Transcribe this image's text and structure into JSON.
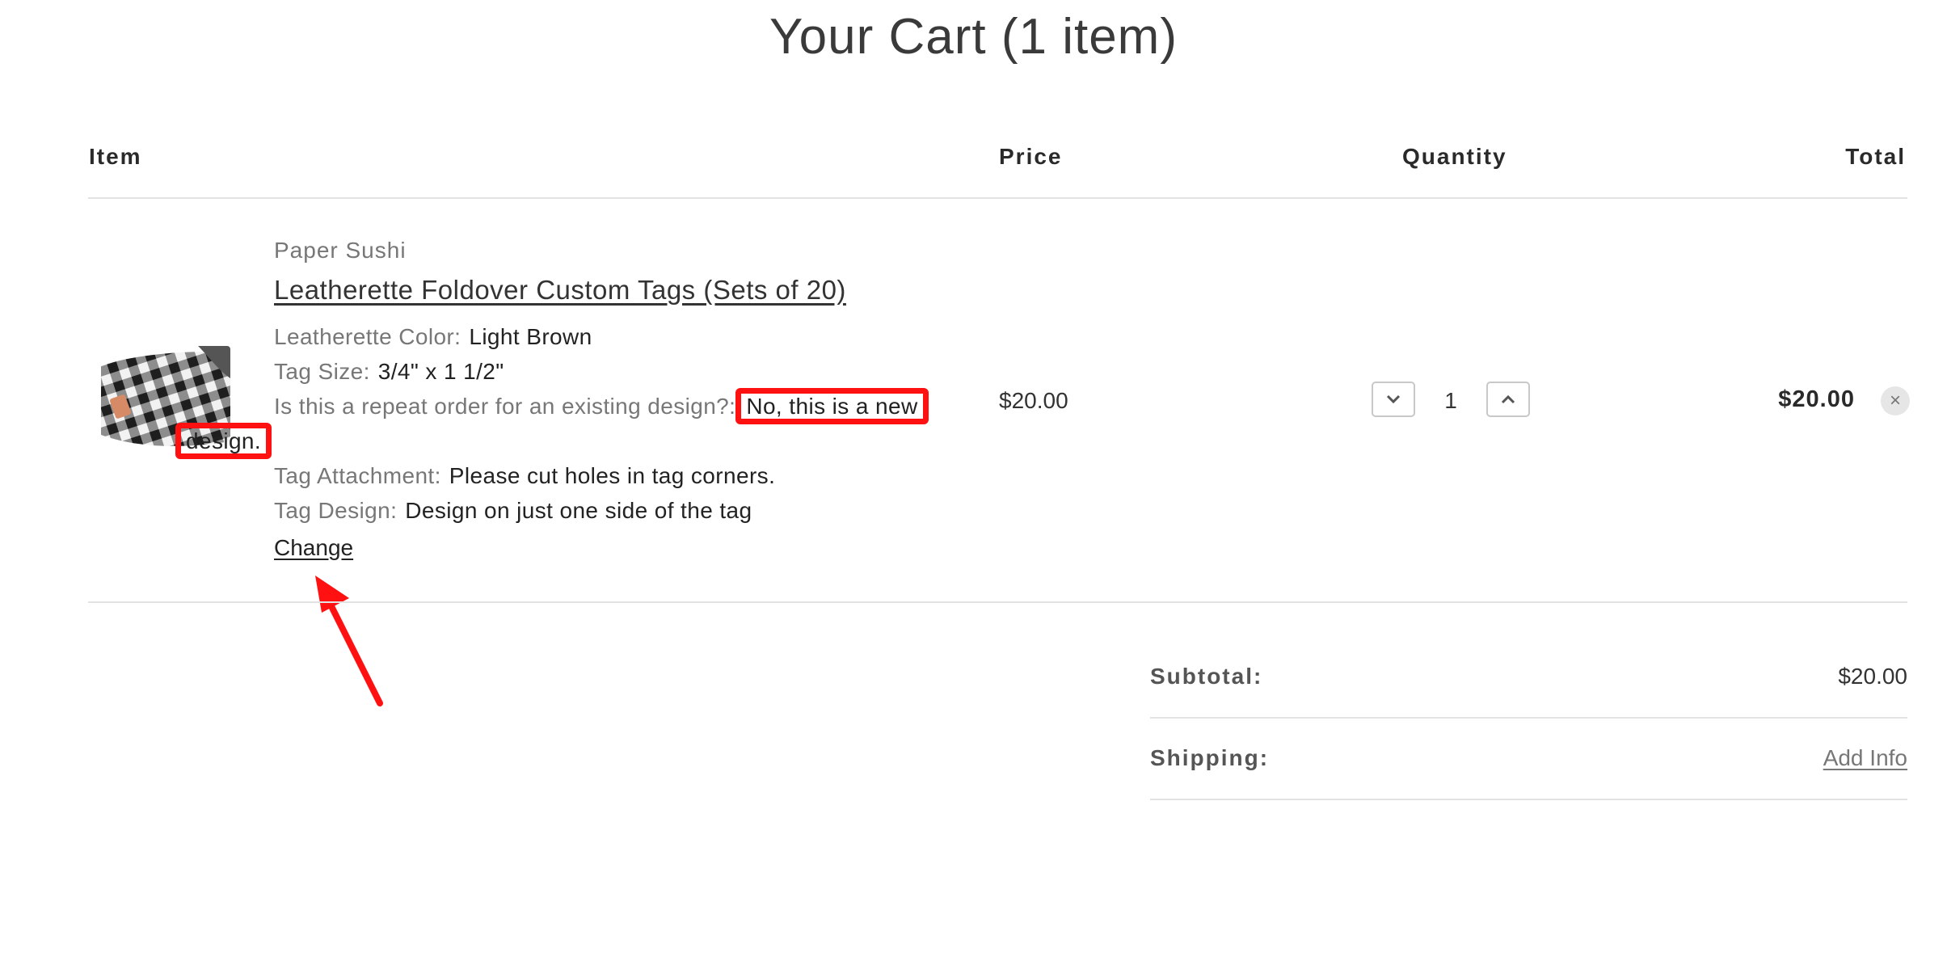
{
  "title": "Your Cart (1 item)",
  "columns": {
    "item": "Item",
    "price": "Price",
    "quantity": "Quantity",
    "total": "Total"
  },
  "line_item": {
    "vendor": "Paper Sushi",
    "name": "Leatherette Foldover Custom Tags (Sets of 20)",
    "properties": [
      {
        "label": "Leatherette Color:",
        "value": "Light Brown"
      },
      {
        "label": "Tag Size:",
        "value": "3/4\" x 1 1/2\""
      },
      {
        "label": "Is this a repeat order for an existing design?:",
        "value_part1": "No, this is a new",
        "value_part2": "design."
      },
      {
        "label": "Tag Attachment:",
        "value": "Please cut holes in tag corners."
      },
      {
        "label": "Tag Design:",
        "value": "Design on just one side of the tag"
      }
    ],
    "change_label": "Change",
    "price": "$20.00",
    "quantity": "1",
    "total": "$20.00",
    "remove_symbol": "×"
  },
  "summary": {
    "subtotal_label": "Subtotal:",
    "subtotal_value": "$20.00",
    "shipping_label": "Shipping:",
    "shipping_value": "Add Info"
  },
  "colors": {
    "highlight": "#ff1111",
    "rule": "#e2e2e2"
  },
  "icons": {
    "decrease": "chevron-down-icon",
    "increase": "chevron-up-icon",
    "remove": "close-icon",
    "annotation": "arrow-icon"
  }
}
